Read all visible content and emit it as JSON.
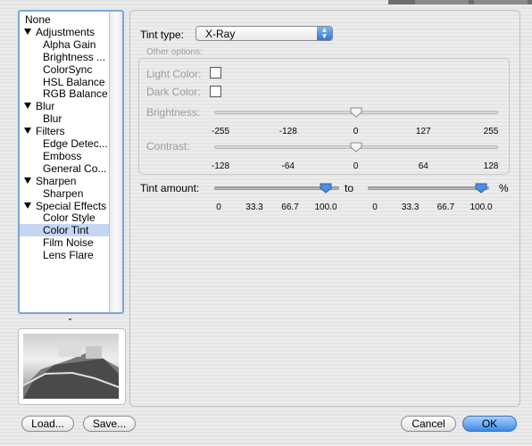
{
  "window_tabs": [
    "",
    ""
  ],
  "effects": {
    "items": [
      {
        "label": "None",
        "type": "none"
      },
      {
        "label": "Adjustments",
        "type": "cat"
      },
      {
        "label": "Alpha Gain",
        "type": "item"
      },
      {
        "label": "Brightness ...",
        "type": "item"
      },
      {
        "label": "ColorSync",
        "type": "item"
      },
      {
        "label": "HSL Balance",
        "type": "item"
      },
      {
        "label": "RGB Balance",
        "type": "item"
      },
      {
        "label": "Blur",
        "type": "cat"
      },
      {
        "label": "Blur",
        "type": "item"
      },
      {
        "label": "Filters",
        "type": "cat"
      },
      {
        "label": "Edge Detec...",
        "type": "item"
      },
      {
        "label": "Emboss",
        "type": "item"
      },
      {
        "label": "General Co...",
        "type": "item"
      },
      {
        "label": "Sharpen",
        "type": "cat"
      },
      {
        "label": "Sharpen",
        "type": "item"
      },
      {
        "label": "Special Effects",
        "type": "cat"
      },
      {
        "label": "Color Style",
        "type": "item"
      },
      {
        "label": "Color Tint",
        "type": "item",
        "selected": true
      },
      {
        "label": "Film Noise",
        "type": "item"
      },
      {
        "label": "Lens Flare",
        "type": "item"
      }
    ]
  },
  "tint_type": {
    "label": "Tint type:",
    "value": "X-Ray"
  },
  "other_options": {
    "title": "Other options:",
    "light_color": "Light Color:",
    "dark_color": "Dark Color:",
    "brightness": {
      "label": "Brightness:",
      "ticks": [
        "-255",
        "-128",
        "0",
        "127",
        "255"
      ],
      "value": 0,
      "min": -255,
      "max": 255
    },
    "contrast": {
      "label": "Contrast:",
      "ticks": [
        "-128",
        "-64",
        "0",
        "64",
        "128"
      ],
      "value": 0,
      "min": -128,
      "max": 128
    }
  },
  "tint_amount": {
    "label": "Tint amount:",
    "to_label": "to",
    "unit": "%",
    "from": {
      "ticks": [
        "0",
        "33.3",
        "66.7",
        "100.0"
      ],
      "value": 100
    },
    "to": {
      "ticks": [
        "0",
        "33.3",
        "66.7",
        "100.0"
      ],
      "value": 100
    }
  },
  "buttons": {
    "load": "Load...",
    "save": "Save...",
    "cancel": "Cancel",
    "ok": "OK"
  }
}
